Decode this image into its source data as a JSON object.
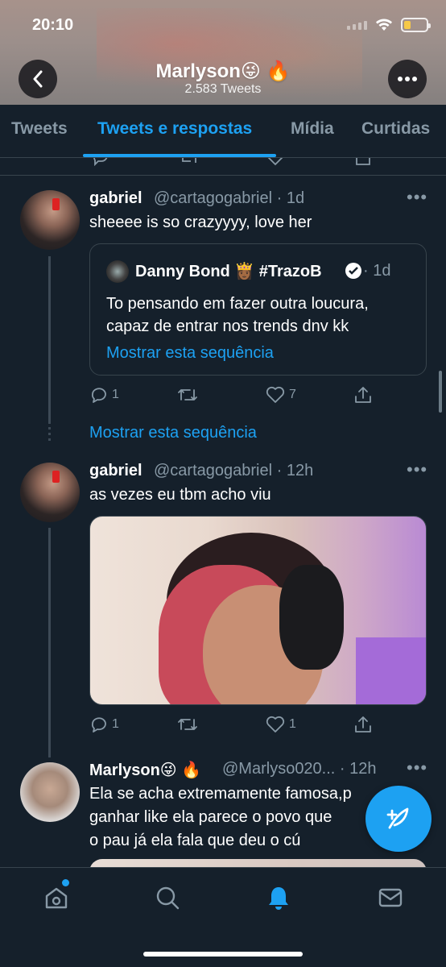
{
  "status_bar": {
    "time": "20:10",
    "battery_color": "#f7c948",
    "battery_level": 0.3
  },
  "header": {
    "title": "Marlyson😜 🔥",
    "subtitle": "2.583 Tweets"
  },
  "tabs": [
    {
      "label": "Tweets",
      "active": false
    },
    {
      "label": "Tweets e respostas",
      "active": true
    },
    {
      "label": "Mídia",
      "active": false
    },
    {
      "label": "Curtidas",
      "active": false
    }
  ],
  "tweets": [
    {
      "name": "gabriel",
      "meta": "@cartagogabriel · 1d",
      "text": "sheeee is so crazyyyy, love her",
      "quote": {
        "name": "Danny Bond 👸🏾 #TrazoB",
        "date": "· 1d",
        "text_line1": "To pensando em fazer outra loucura,",
        "text_line2": "capaz de entrar nos trends dnv kk",
        "link": "Mostrar esta sequência"
      },
      "replies": "1",
      "retweets": "",
      "likes": "7"
    },
    {
      "thread_link": "Mostrar esta sequência"
    },
    {
      "name": "gabriel",
      "meta": "@cartagogabriel · 12h",
      "text": "as vezes eu tbm acho viu",
      "replies": "1",
      "retweets": "",
      "likes": "1"
    },
    {
      "name": "Marlyson😜 🔥",
      "meta": "@Marlyso020... · 12h",
      "text_line1": "Ela se acha extremamente famosa,p",
      "text_line2": "ganhar like ela parece o povo que",
      "text_line3": "o pau já ela fala que deu o cú"
    }
  ],
  "colors": {
    "accent": "#1da1f2",
    "background": "#15202b",
    "muted": "#8899a6",
    "border": "#38444d"
  }
}
